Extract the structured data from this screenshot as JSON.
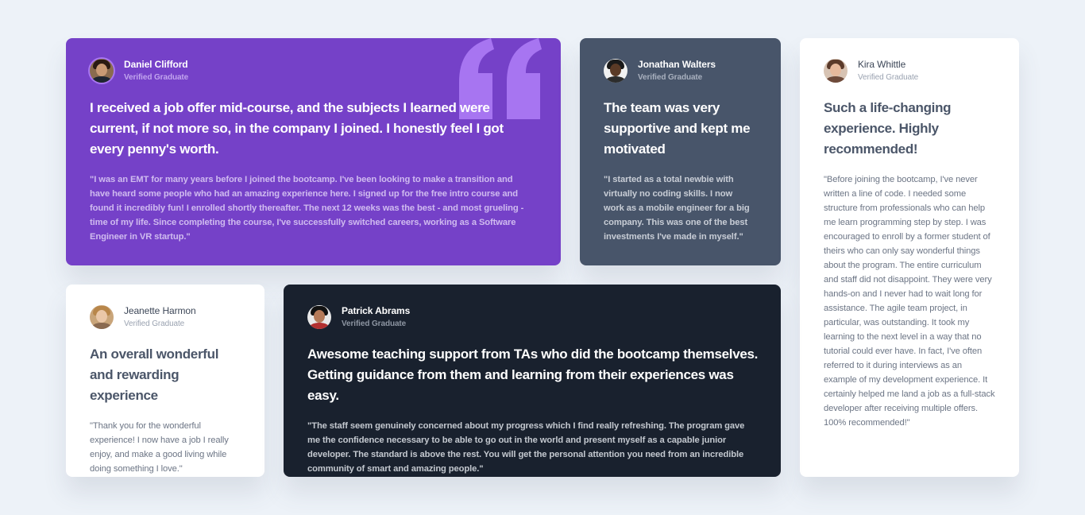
{
  "testimonials": [
    {
      "name": "Daniel Clifford",
      "role": "Verified Graduate",
      "headline": "I received a job offer mid-course, and the subjects I learned were current, if not more so, in the company I joined. I honestly feel I got every penny's worth.",
      "quote": "\"I was an EMT for many years before I joined the bootcamp. I've been looking to make a transition and have heard some people who had an amazing experience here. I signed up for the free intro course and found it incredibly fun! I enrolled shortly thereafter. The next 12 weeks was the best - and most grueling - time of my life. Since completing the course, I've successfully switched careers, working as a Software Engineer in VR startup.\"",
      "avatar_icon": "avatar-daniel-icon"
    },
    {
      "name": "Jonathan Walters",
      "role": "Verified Graduate",
      "headline": "The team was very supportive and kept me motivated",
      "quote": "\"I started as a total newbie with virtually no coding skills. I now work as a mobile engineer for a big company. This was one of the best investments I've made in myself.\"",
      "avatar_icon": "avatar-jonathan-icon"
    },
    {
      "name": "Kira Whittle",
      "role": "Verified Graduate",
      "headline": "Such a life-changing experience. Highly recommended!",
      "quote": "\"Before joining the bootcamp, I've never written a line of code. I needed some structure from professionals who can help me learn programming step by step. I was encouraged to enroll by a former student of theirs who can only say wonderful things about the program. The entire curriculum and staff did not disappoint. They were very hands-on and I never had to wait long for assistance. The agile team project, in particular, was outstanding. It took my learning to the next level in a way that no tutorial could ever have. In fact, I've often referred to it during interviews as an example of my development experience. It certainly helped me land a job as a full-stack developer after receiving multiple offers. 100% recommended!\"",
      "avatar_icon": "avatar-kira-icon"
    },
    {
      "name": "Jeanette Harmon",
      "role": "Verified Graduate",
      "headline": "An overall wonderful and rewarding experience",
      "quote": "\"Thank you for the wonderful experience! I now have a job I really enjoy, and make a good living while doing something I love.\"",
      "avatar_icon": "avatar-jeanette-icon"
    },
    {
      "name": "Patrick Abrams",
      "role": "Verified Graduate",
      "headline": "Awesome teaching support from TAs who did the bootcamp themselves. Getting guidance from them and learning from their experiences was easy.",
      "quote": "\"The staff seem genuinely concerned about my progress which I find really refreshing. The program gave me the confidence necessary to be able to go out in the world and present myself as a capable junior developer. The standard is above the rest. You will get the personal attention you need from an incredible community of smart and amazing people.\"",
      "avatar_icon": "avatar-patrick-icon"
    }
  ],
  "decor": {
    "quote_icon": "quotation-mark-icon"
  },
  "colors": {
    "background": "#edf2f8",
    "purple": "#7541c8",
    "slate": "#48556a",
    "white": "#ffffff",
    "dark": "#19212e",
    "quote_mark": "#a775f1"
  }
}
